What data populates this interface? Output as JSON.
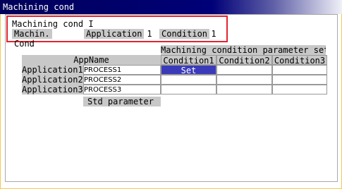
{
  "window": {
    "title": "Machining cond"
  },
  "header": {
    "section_title": "Machining cond I",
    "machin_cond_label": "Machin. Cond",
    "application_label": "Application",
    "application_value": "1",
    "condition_label": "Condition",
    "condition_value": "1"
  },
  "table": {
    "group_header": "Machining condition parameter set",
    "appname_header": "AppName",
    "condition_headers": [
      "Condition1",
      "Condition2",
      "Condition3"
    ],
    "rows": [
      {
        "label": "Application1",
        "appname": "PROCESS1",
        "cells": [
          "Set",
          "",
          ""
        ]
      },
      {
        "label": "Application2",
        "appname": "PROCESS2",
        "cells": [
          "",
          "",
          ""
        ]
      },
      {
        "label": "Application3",
        "appname": "PROCESS3",
        "cells": [
          "",
          "",
          ""
        ]
      }
    ],
    "std_parameter_label": "Std parameter",
    "std_parameter_value": ""
  }
}
